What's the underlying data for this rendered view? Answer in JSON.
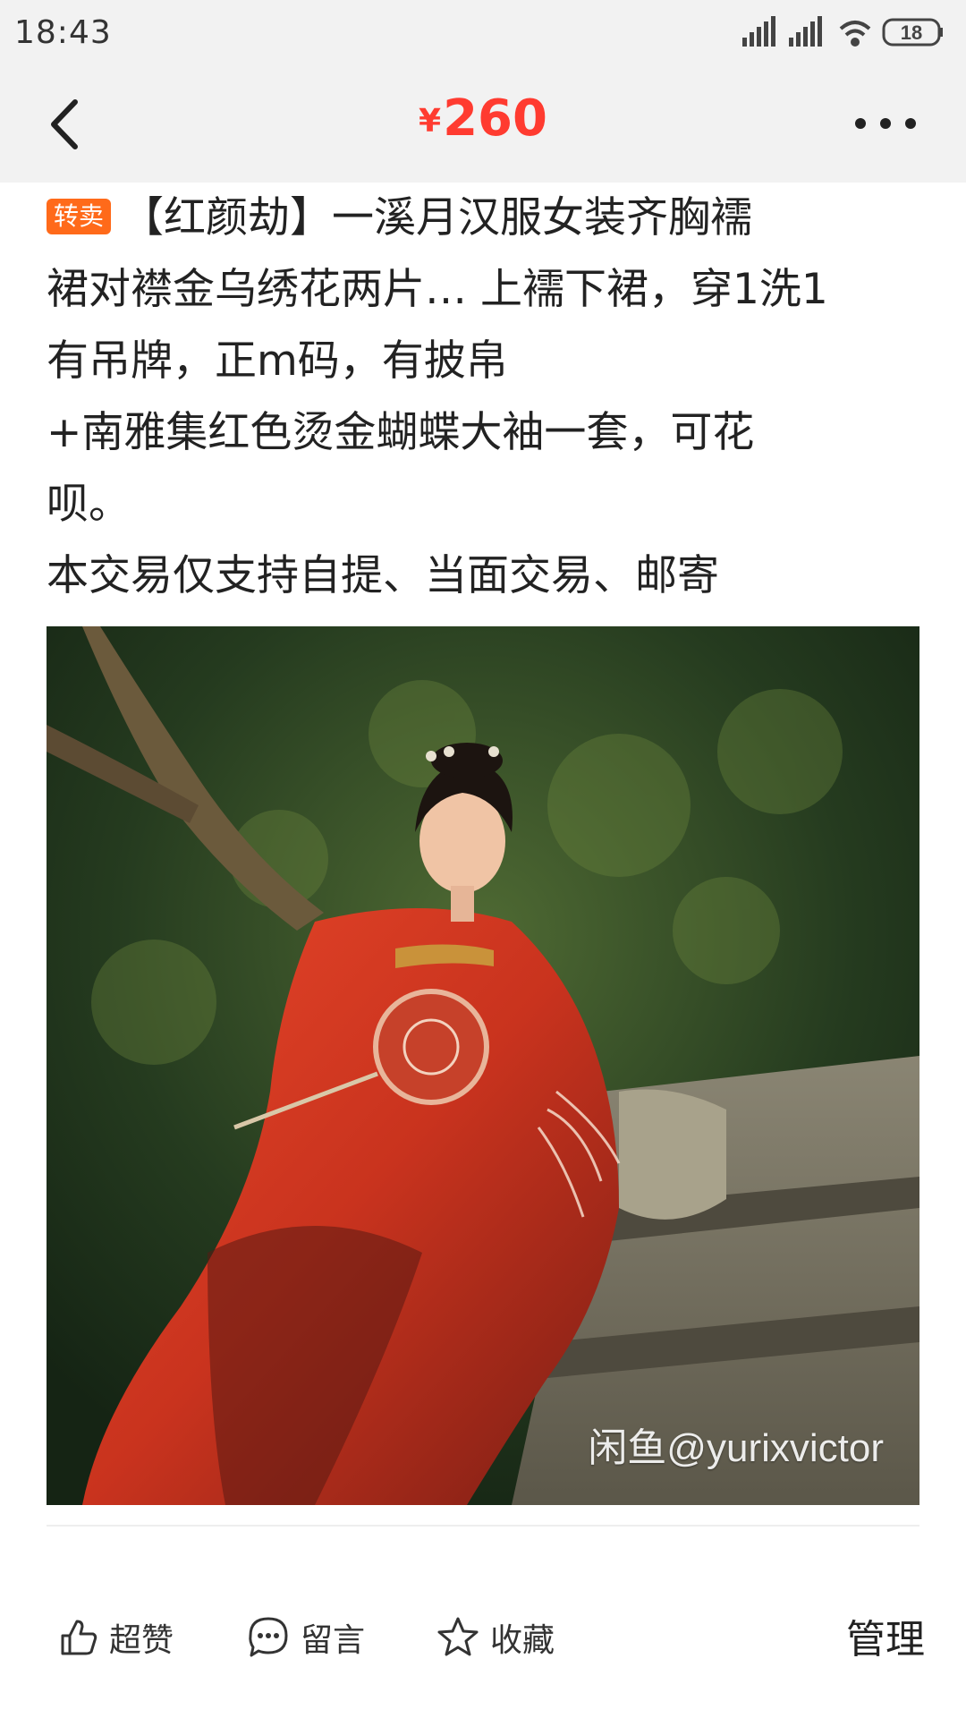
{
  "status_bar": {
    "time": "18:43",
    "battery": "18"
  },
  "header": {
    "currency_symbol": "¥",
    "price": "260"
  },
  "listing": {
    "tag": "转卖",
    "lines": [
      "【红颜劫】一溪月汉服女装齐胸襦",
      "裙对襟金乌绣花两片… 上襦下裙，穿1洗1",
      "有吊牌，正m码，有披帛",
      "+南雅集红色烫金蝴蝶大袖一套，可花",
      "呗。",
      "本交易仅支持自提、当面交易、邮寄"
    ]
  },
  "photo": {
    "watermark": "闲鱼@yurixvictor"
  },
  "actions": {
    "like_label": "超赞",
    "comment_label": "留言",
    "favorite_label": "收藏",
    "manage_label": "管理"
  },
  "colors": {
    "price": "#ff3b30",
    "tag_bg": "#ff6a1a",
    "header_bg": "#f2f2f2"
  }
}
